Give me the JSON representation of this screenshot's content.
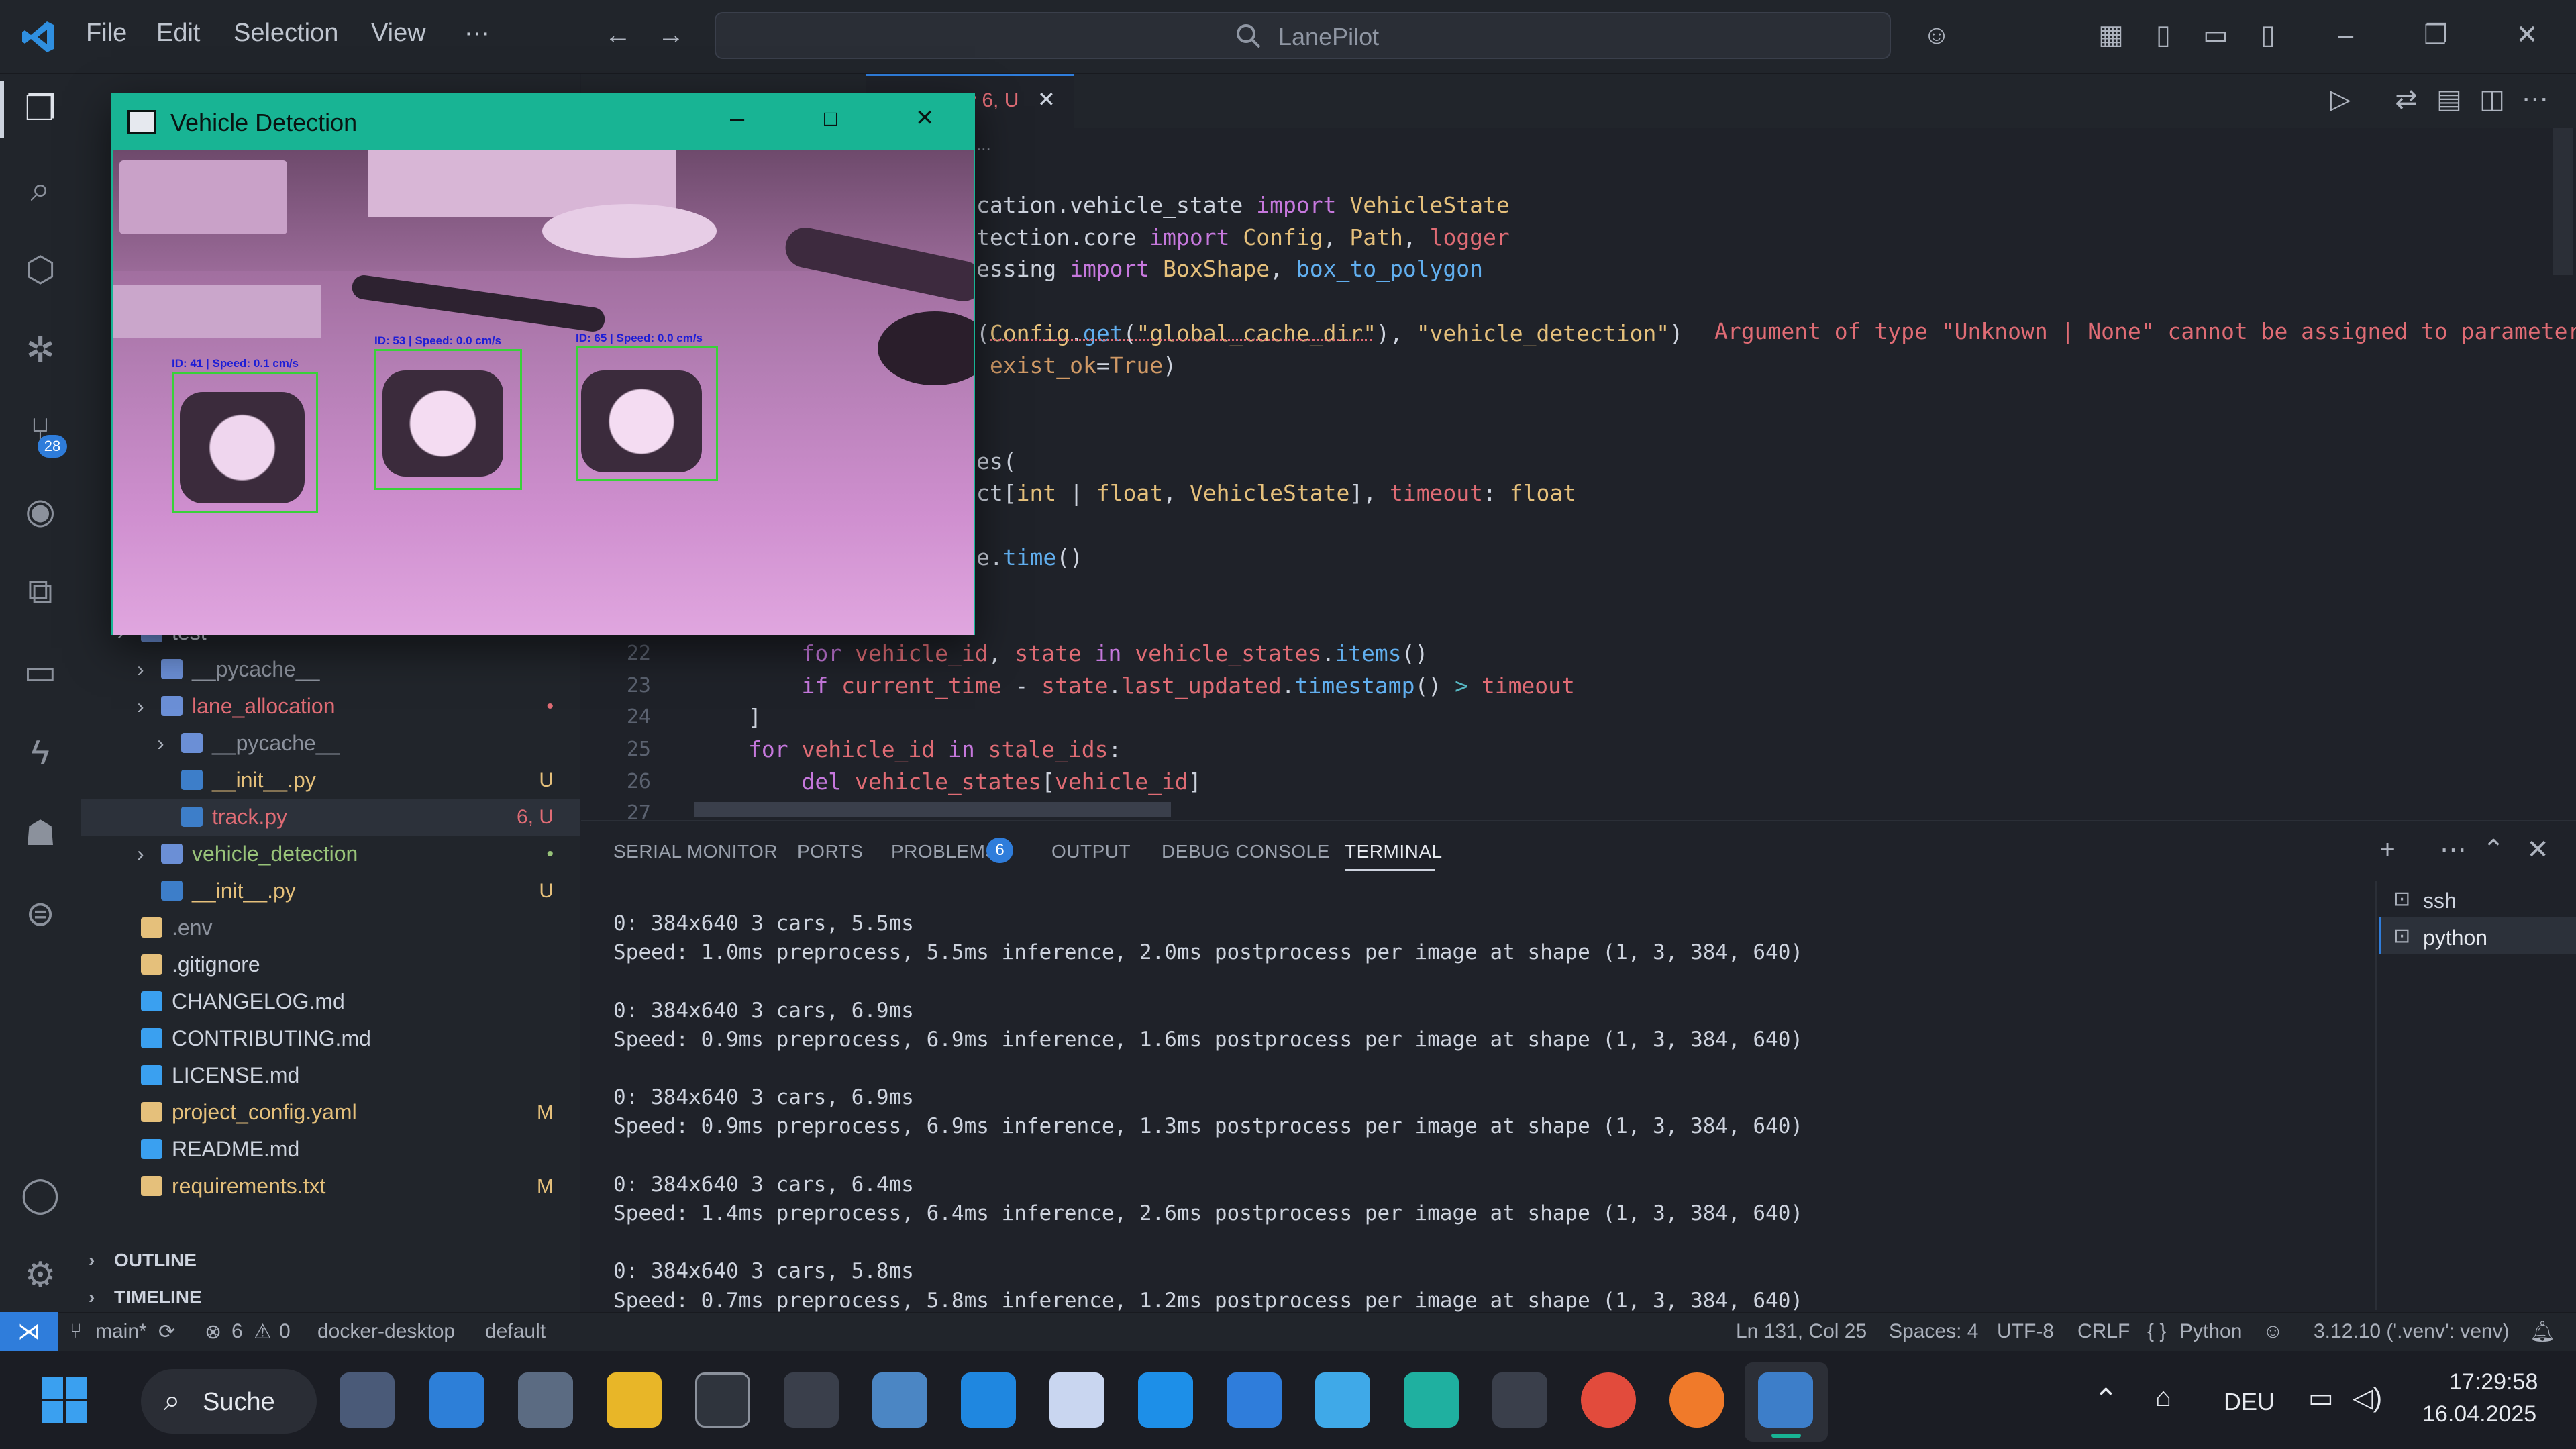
{
  "menu": {
    "file": "File",
    "edit": "Edit",
    "selection": "Selection",
    "view": "View",
    "more": "···"
  },
  "search": {
    "placeholder": "LanePilot"
  },
  "activity": {
    "scm_badge": "28"
  },
  "explorer": {
    "rows": [
      {
        "label": "test",
        "indent": 0,
        "badge": "",
        "color": "#cdd3de"
      },
      {
        "label": "__pycache__",
        "indent": 1,
        "badge": "",
        "color": "#8b919c"
      },
      {
        "label": "lane_allocation",
        "indent": 1,
        "badge": "•",
        "color": "#e06c75"
      },
      {
        "label": "__pycache__",
        "indent": 2,
        "badge": "",
        "color": "#8b919c"
      },
      {
        "label": "__init__.py",
        "indent": 2,
        "badge": "U",
        "color": "#e5c07b"
      },
      {
        "label": "track.py",
        "indent": 2,
        "badge": "6, U",
        "color": "#e06c75"
      },
      {
        "label": "vehicle_detection",
        "indent": 1,
        "badge": "•",
        "color": "#98c379"
      },
      {
        "label": "__init__.py",
        "indent": 1,
        "badge": "U",
        "color": "#e5c07b"
      },
      {
        "label": ".env",
        "indent": 0,
        "badge": "",
        "color": "#8b919c"
      },
      {
        "label": ".gitignore",
        "indent": 0,
        "badge": "",
        "color": "#cdd3de"
      },
      {
        "label": "CHANGELOG.md",
        "indent": 0,
        "badge": "",
        "color": "#cdd3de"
      },
      {
        "label": "CONTRIBUTING.md",
        "indent": 0,
        "badge": "",
        "color": "#cdd3de"
      },
      {
        "label": "LICENSE.md",
        "indent": 0,
        "badge": "",
        "color": "#cdd3de"
      },
      {
        "label": "project_config.yaml",
        "indent": 0,
        "badge": "M",
        "color": "#e5c07b"
      },
      {
        "label": "README.md",
        "indent": 0,
        "badge": "",
        "color": "#cdd3de"
      },
      {
        "label": "requirements.txt",
        "indent": 0,
        "badge": "M",
        "color": "#e5c07b"
      }
    ],
    "outline": "OUTLINE",
    "timeline": "TIMELINE"
  },
  "editor": {
    "tab_label": "y 6, U",
    "breadcrumb": "...",
    "lines": [
      {
        "num": "",
        "html": "cation.vehicle_state <span class=\"kw\">import</span> <span class=\"cls\">VehicleState</span>"
      },
      {
        "num": "",
        "html": "tection.core <span class=\"kw\">import</span> <span class=\"cls\">Config</span>, <span class=\"cls\">Path</span>, <span class=\"var\">logger</span>"
      },
      {
        "num": "",
        "html": "essing <span class=\"kw\">import</span> <span class=\"cls\">BoxShape</span>, <span class=\"fn\">box_to_polygon</span>"
      },
      {
        "num": "",
        "html": ""
      },
      {
        "num": "",
        "html": "(<span class=\"cls\">Config</span>.<span class=\"fn\">get</span>(<span class=\"str\">\"global_cache_dir\"</span>), <span class=\"str\">\"vehicle_detection\"</span>)"
      },
      {
        "num": "",
        "html": " <span class=\"par\">exist_ok</span>=<span class=\"par\">True</span>)"
      },
      {
        "num": "",
        "html": ""
      },
      {
        "num": "",
        "html": ""
      },
      {
        "num": "",
        "html": "es("
      },
      {
        "num": "",
        "html": "ct[<span class=\"cls\">int</span> | <span class=\"cls\">float</span>, <span class=\"cls\">VehicleState</span>], <span class=\"var\">timeout</span>: <span class=\"cls\">float</span>"
      },
      {
        "num": "",
        "html": ""
      },
      {
        "num": "",
        "html": "e.<span class=\"fn\">time</span>()"
      },
      {
        "num": "",
        "html": ""
      },
      {
        "num": "",
        "html": ""
      },
      {
        "num": "22",
        "html": "    <span class=\"kw\">for</span> <span class=\"var\">vehicle_id</span>, <span class=\"var\">state</span> <span class=\"kw\">in</span> <span class=\"var\">vehicle_states</span>.<span class=\"fn\">items</span>()"
      },
      {
        "num": "23",
        "html": "    <span class=\"kw\">if</span> <span class=\"var\">current_time</span> - <span class=\"var\">state</span>.<span class=\"var\">last_updated</span>.<span class=\"fn\">timestamp</span>() <span class=\"op\">&gt;</span> <span class=\"var\">timeout</span>"
      },
      {
        "num": "24",
        "html": "]"
      },
      {
        "num": "25",
        "html": "<span class=\"kw\">for</span> <span class=\"var\">vehicle_id</span> <span class=\"kw\">in</span> <span class=\"var\">stale_ids</span>:"
      },
      {
        "num": "26",
        "html": "    <span class=\"kw\">del</span> <span class=\"var\">vehicle_states</span>[<span class=\"var\">vehicle_id</span>]"
      },
      {
        "num": "27",
        "html": ""
      }
    ],
    "error_message": "Argument of type \"Unknown | None\" cannot be assigned to parameter"
  },
  "panel": {
    "tabs": [
      "SERIAL MONITOR",
      "PORTS",
      "PROBLEMS",
      "OUTPUT",
      "DEBUG CONSOLE",
      "TERMINAL"
    ],
    "problems_count": "6",
    "terminals": [
      "ssh",
      "python"
    ],
    "lines": [
      "0: 384x640 3 cars, 5.5ms",
      "Speed: 1.0ms preprocess, 5.5ms inference, 2.0ms postprocess per image at shape (1, 3, 384, 640)",
      "",
      "0: 384x640 3 cars, 6.9ms",
      "Speed: 0.9ms preprocess, 6.9ms inference, 1.6ms postprocess per image at shape (1, 3, 384, 640)",
      "",
      "0: 384x640 3 cars, 6.9ms",
      "Speed: 0.9ms preprocess, 6.9ms inference, 1.3ms postprocess per image at shape (1, 3, 384, 640)",
      "",
      "0: 384x640 3 cars, 6.4ms",
      "Speed: 1.4ms preprocess, 6.4ms inference, 2.6ms postprocess per image at shape (1, 3, 384, 640)",
      "",
      "0: 384x640 3 cars, 5.8ms",
      "Speed: 0.7ms preprocess, 5.8ms inference, 1.2ms postprocess per image at shape (1, 3, 384, 640)"
    ]
  },
  "status": {
    "branch": "main*",
    "errors": "6",
    "warnings": "0",
    "docker": "docker-desktop",
    "profile": "default",
    "position": "Ln 131, Col 25",
    "spaces": "Spaces: 4",
    "encoding": "UTF-8",
    "eol": "CRLF",
    "language": "Python",
    "interpreter": "3.12.10 ('.venv': venv)"
  },
  "vehicle_window": {
    "title": "Vehicle Detection",
    "detections": [
      {
        "label": "ID: 41 | Speed: 0.1 cm/s"
      },
      {
        "label": "ID: 53 | Speed: 0.0 cm/s"
      },
      {
        "label": "ID: 65 | Speed: 0.0 cm/s"
      }
    ]
  },
  "taskbar": {
    "search_label": "Suche",
    "language": "DEU",
    "time": "17:29:58",
    "date": "16.04.2025"
  },
  "colors": {
    "accent": "#18b494",
    "statusbar_remote": "#2f7ddb",
    "error": "#e06c75"
  }
}
